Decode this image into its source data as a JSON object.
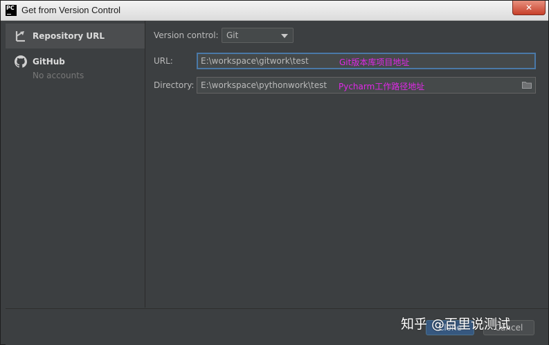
{
  "window": {
    "title": "Get from Version Control",
    "app_icon_text": "PC",
    "close_glyph": "✕"
  },
  "sidebar": {
    "items": [
      {
        "label": "Repository URL",
        "icon": "vcs-arrow-icon",
        "selected": true
      },
      {
        "label": "GitHub",
        "sublabel": "No accounts",
        "icon": "github-icon",
        "selected": false
      }
    ]
  },
  "form": {
    "version_control": {
      "label": "Version control:",
      "value": "Git"
    },
    "url": {
      "label": "URL:",
      "value": "E:\\workspace\\gitwork\\test",
      "annotation": "Git版本库项目地址"
    },
    "directory": {
      "label": "Directory:",
      "value": "E:\\workspace\\pythonwork\\test",
      "annotation": "Pycharm工作路径地址",
      "icon": "folder-icon"
    }
  },
  "footer": {
    "clone_label": "Clone",
    "cancel_label": "Cancel"
  },
  "watermark": "知乎 @百里说测试",
  "colors": {
    "annotation": "#e028e8",
    "panel": "#3c3f41",
    "focus_border": "#4a79a8"
  }
}
